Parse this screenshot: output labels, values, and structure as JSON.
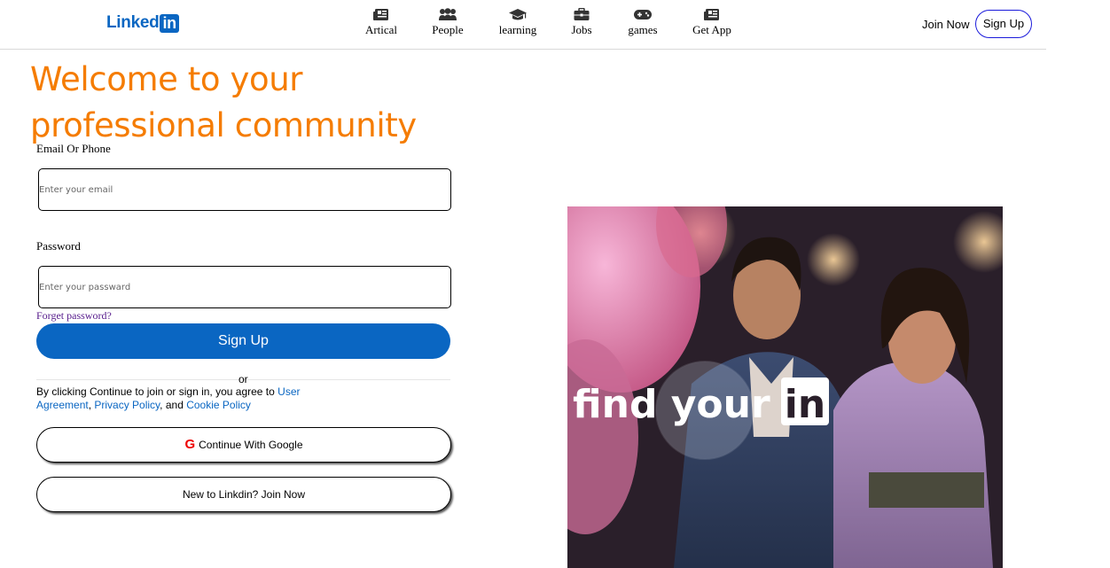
{
  "header": {
    "logo_text": "Linked",
    "logo_box_text": "in",
    "nav": [
      {
        "label": "Artical",
        "icon": "newspaper-icon"
      },
      {
        "label": "People",
        "icon": "people-icon"
      },
      {
        "label": "learning",
        "icon": "graduation-cap-icon"
      },
      {
        "label": "Jobs",
        "icon": "briefcase-icon"
      },
      {
        "label": "games",
        "icon": "gamepad-icon"
      },
      {
        "label": "Get App",
        "icon": "newspaper-icon"
      }
    ],
    "join_now": "Join Now",
    "sign_up": "Sign Up"
  },
  "main": {
    "welcome_line1": "Welcome to your",
    "welcome_line2": "professional community",
    "email_label": "Email Or Phone",
    "email_placeholder": "Enter your email",
    "password_label": "Password",
    "password_placeholder": "Enter your passward",
    "forget": "Forget password?",
    "signup_button": "Sign Up",
    "or": "or",
    "terms_prefix": "By clicking Continue to join or sign in, you agree to ",
    "terms_user": "User Agreement",
    "terms_comma": ", ",
    "terms_privacy": "Privacy Policy",
    "terms_and": ", and ",
    "terms_cookie": "Cookie Policy",
    "google_button": "Continue With Google",
    "google_icon_letter": "G",
    "join_button": "New to Linkdin? Join Now"
  },
  "hero": {
    "text": "find your",
    "badge": "in"
  },
  "colors": {
    "brand": "#0a66c2",
    "welcome": "#f57c00",
    "google": "#ee0000"
  }
}
